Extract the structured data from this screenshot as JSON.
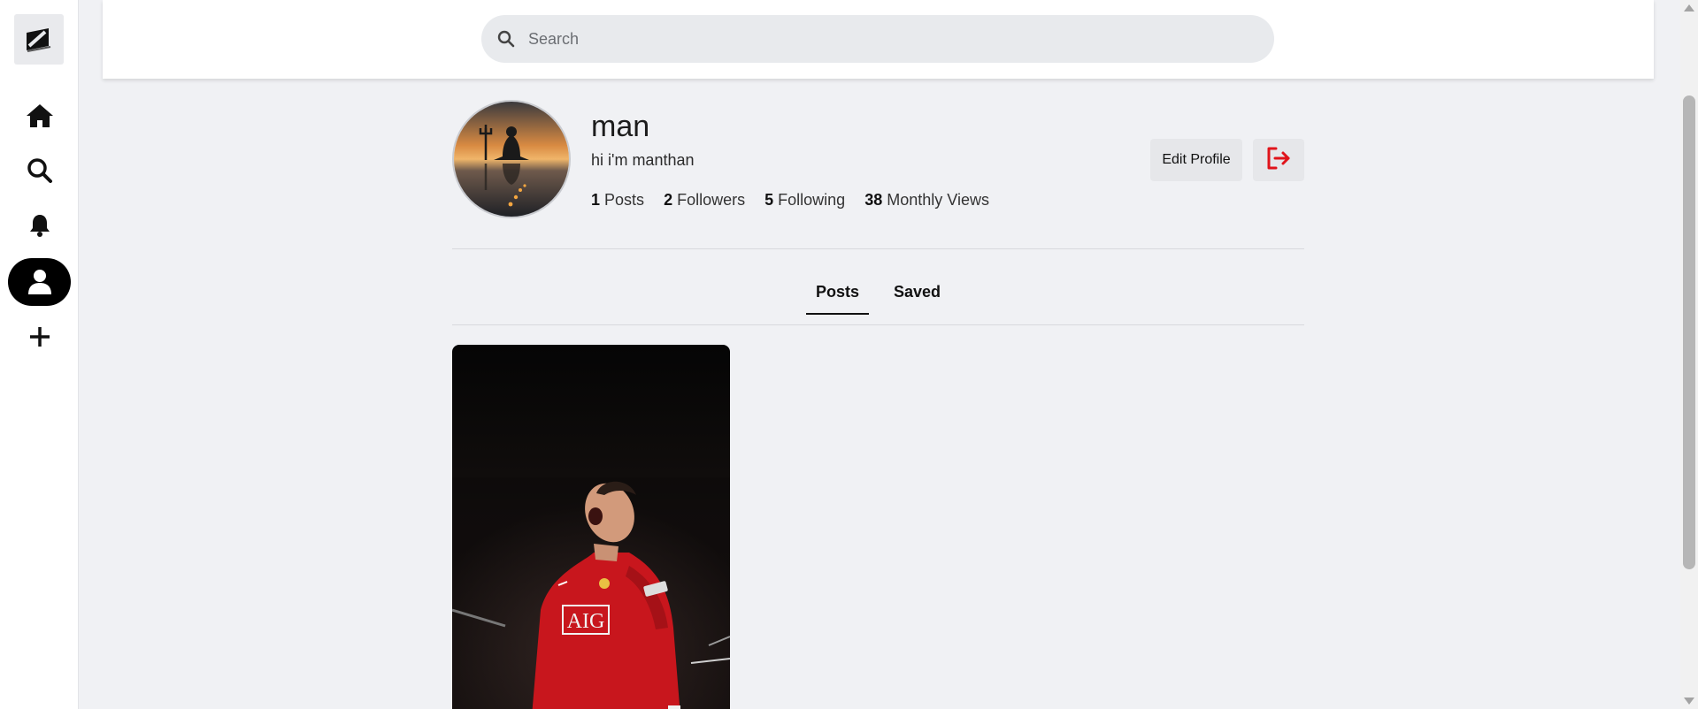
{
  "app": {
    "logo_icon": "app-logo-icon"
  },
  "sidebar": {
    "items": [
      {
        "name": "home",
        "icon": "home-icon",
        "active": false
      },
      {
        "name": "search",
        "icon": "search-icon",
        "active": false
      },
      {
        "name": "notifications",
        "icon": "bell-icon",
        "active": false
      },
      {
        "name": "profile",
        "icon": "user-icon",
        "active": true
      },
      {
        "name": "create",
        "icon": "plus-icon",
        "active": false
      }
    ]
  },
  "header": {
    "search": {
      "placeholder": "Search",
      "value": ""
    }
  },
  "profile": {
    "username": "man",
    "bio": "hi i'm manthan",
    "stats": {
      "posts_count": "1",
      "posts_label": "Posts",
      "followers_count": "2",
      "followers_label": "Followers",
      "following_count": "5",
      "following_label": "Following",
      "views_count": "38",
      "views_label": "Monthly Views"
    },
    "edit_label": "Edit Profile",
    "logout_icon": "logout-icon"
  },
  "tabs": [
    {
      "label": "Posts",
      "active": true
    },
    {
      "label": "Saved",
      "active": false
    }
  ],
  "posts": [
    {
      "thumbnail": "post-image",
      "jersey_text": "AIG"
    }
  ],
  "colors": {
    "accent": "#000000",
    "background": "#f0f1f4",
    "danger": "#e0141b"
  }
}
